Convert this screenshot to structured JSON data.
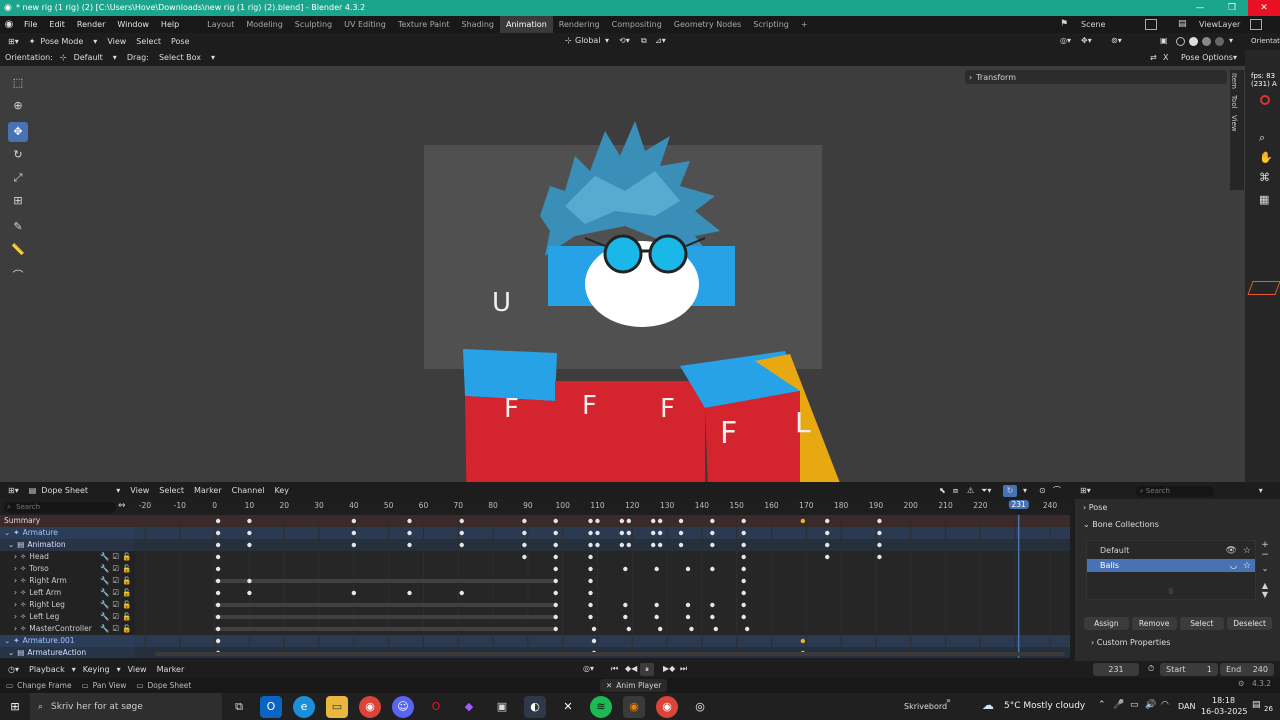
{
  "window": {
    "title": "* new rig (1 rig) (2) [C:\\Users\\Hove\\Downloads\\new rig (1 rig) (2).blend] - Blender 4.3.2",
    "minimize": "—",
    "maximize": "❐",
    "close": "✕"
  },
  "menu": [
    "File",
    "Edit",
    "Render",
    "Window",
    "Help"
  ],
  "workspaces": [
    "Layout",
    "Modeling",
    "Sculpting",
    "UV Editing",
    "Texture Paint",
    "Shading",
    "Animation",
    "Rendering",
    "Compositing",
    "Geometry Nodes",
    "Scripting"
  ],
  "workspace_add": "+",
  "scene": {
    "label": "Scene",
    "view_layer": "ViewLayer"
  },
  "viewport_header": {
    "mode": "Pose Mode",
    "menus": [
      "View",
      "Select",
      "Pose"
    ],
    "transform": "Global",
    "orientation_label": "Orientation:",
    "orientation_value": "Default",
    "drag_label": "Drag:",
    "drag_value": "Select Box",
    "pose_options": "Pose Options",
    "close_x": "X"
  },
  "npanel": {
    "transform": "Transform",
    "tabs": [
      "Item",
      "Tool",
      "View"
    ]
  },
  "right_sliver": {
    "header": "Orientat",
    "fps": "fps: 83",
    "frame": "(231) A"
  },
  "character": {
    "letters": [
      "U",
      "F",
      "F",
      "F",
      "F",
      "L"
    ]
  },
  "dopesheet": {
    "editor": "Dope Sheet",
    "menus": [
      "View",
      "Select",
      "Marker",
      "Channel",
      "Key"
    ],
    "search_placeholder": "Search",
    "frame_ticks": [
      "-20",
      "-10",
      "0",
      "10",
      "20",
      "30",
      "40",
      "50",
      "60",
      "70",
      "80",
      "90",
      "100",
      "110",
      "120",
      "130",
      "140",
      "150",
      "160",
      "170",
      "180",
      "190",
      "200",
      "210",
      "220",
      "231",
      "240"
    ],
    "current_frame": "231",
    "channels": [
      {
        "label": "Summary",
        "kind": "summary"
      },
      {
        "label": "Armature",
        "kind": "armature"
      },
      {
        "label": "Animation",
        "kind": "action"
      },
      {
        "label": "Head",
        "kind": "bone"
      },
      {
        "label": "Torso",
        "kind": "bone"
      },
      {
        "label": "Right Arm",
        "kind": "bone"
      },
      {
        "label": "Left Arm",
        "kind": "bone"
      },
      {
        "label": "Right Leg",
        "kind": "bone"
      },
      {
        "label": "Left Leg",
        "kind": "bone"
      },
      {
        "label": "MasterController",
        "kind": "bone"
      },
      {
        "label": "Armature.001",
        "kind": "armature"
      },
      {
        "label": "ArmatureAction",
        "kind": "action"
      }
    ]
  },
  "props": {
    "search_placeholder": "Search",
    "pose": "Pose",
    "bone_collections": "Bone Collections",
    "collections": [
      "Default",
      "Balls"
    ],
    "buttons": [
      "Assign",
      "Remove",
      "Select",
      "Deselect"
    ],
    "custom_properties": "Custom Properties"
  },
  "timeline": {
    "menus": [
      "Playback",
      "Keying",
      "View",
      "Marker"
    ],
    "current": "231",
    "start_label": "Start",
    "start": "1",
    "end_label": "End",
    "end": "240"
  },
  "status": {
    "items": [
      "Change Frame",
      "Pan View",
      "Dope Sheet"
    ],
    "anim_player": "Anim Player",
    "version": "4.3.2"
  },
  "taskbar": {
    "search": "Skriv her for at søge",
    "desktop": "Skrivebord",
    "weather": "5°C  Mostly cloudy",
    "lang": "DAN",
    "time": "18:18",
    "date": "16-03-2025",
    "notif": "26"
  }
}
